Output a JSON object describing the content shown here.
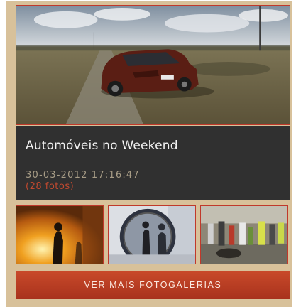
{
  "gallery": {
    "title": "Automóveis no Weekend",
    "date": "30-03-2012 17:16:47",
    "photo_count": "(28 fotos)",
    "more_button": "VER MAIS FOTOGALERIAS"
  },
  "colors": {
    "panel_bg": "#d8c19a",
    "info_bg": "#303030",
    "accent": "#c0392b",
    "button": "#b83d22"
  }
}
